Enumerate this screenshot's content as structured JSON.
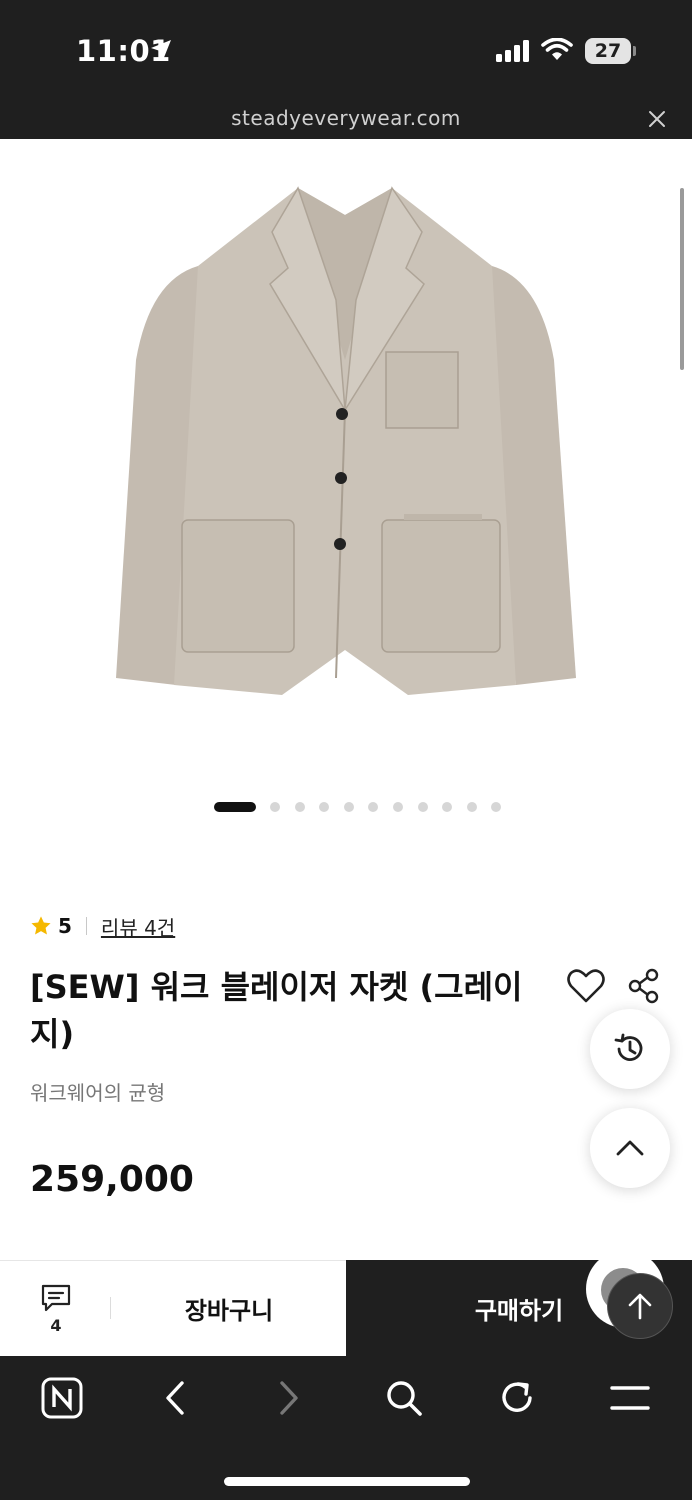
{
  "status_bar": {
    "time": "11:01",
    "battery": "27"
  },
  "browser": {
    "url": "steadyeverywear.com"
  },
  "gallery": {
    "total_images": 11,
    "active_index": 0
  },
  "product": {
    "rating": "5",
    "review_link": "리뷰 4건",
    "title": "[SEW] 워크 블레이저 자켓 (그레이지)",
    "subtitle": "워크웨어의 균형",
    "price": "259,000"
  },
  "action_bar": {
    "chat_count": "4",
    "cart_label": "장바구니",
    "buy_label": "구매하기"
  },
  "colors": {
    "dark_bg": "#1f1f1f",
    "star": "#f5b800",
    "jacket": "#cbc3b8"
  }
}
